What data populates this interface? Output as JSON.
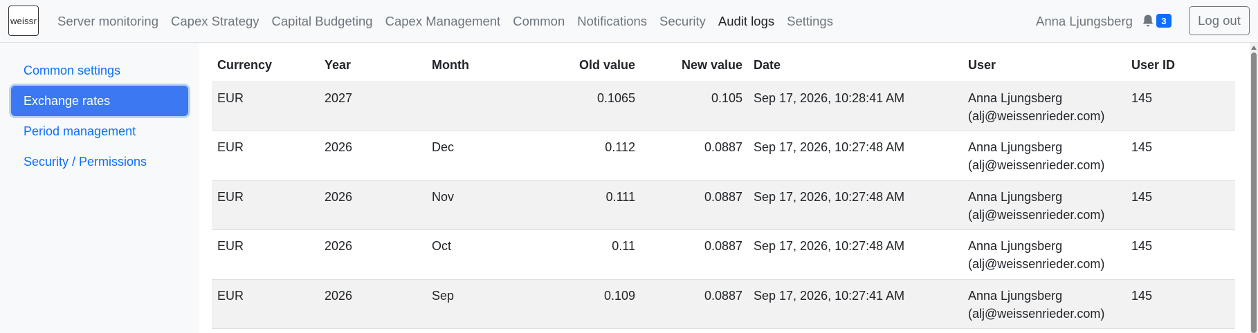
{
  "brand": {
    "text": "weissr"
  },
  "nav": {
    "links": [
      {
        "label": "Server monitoring"
      },
      {
        "label": "Capex Strategy"
      },
      {
        "label": "Capital Budgeting"
      },
      {
        "label": "Capex Management"
      },
      {
        "label": "Common"
      },
      {
        "label": "Notifications"
      },
      {
        "label": "Security"
      },
      {
        "label": "Audit logs"
      },
      {
        "label": "Settings"
      }
    ],
    "user_name": "Anna Ljungsberg",
    "notification_count": "3",
    "logout_label": "Log out"
  },
  "sidebar": {
    "items": [
      {
        "label": "Common settings"
      },
      {
        "label": "Exchange rates"
      },
      {
        "label": "Period management"
      },
      {
        "label": "Security / Permissions"
      }
    ]
  },
  "table": {
    "headers": {
      "currency": "Currency",
      "year": "Year",
      "month": "Month",
      "old_value": "Old value",
      "new_value": "New value",
      "date": "Date",
      "user": "User",
      "user_id": "User ID"
    },
    "rows": [
      {
        "currency": "EUR",
        "year": "2027",
        "month": "",
        "old_value": "0.1065",
        "new_value": "0.105",
        "date": "Sep 17, 2026, 10:28:41 AM",
        "user_name": "Anna Ljungsberg",
        "user_email": "(alj@weissenrieder.com)",
        "user_id": "145"
      },
      {
        "currency": "EUR",
        "year": "2026",
        "month": "Dec",
        "old_value": "0.112",
        "new_value": "0.0887",
        "date": "Sep 17, 2026, 10:27:48 AM",
        "user_name": "Anna Ljungsberg",
        "user_email": "(alj@weissenrieder.com)",
        "user_id": "145"
      },
      {
        "currency": "EUR",
        "year": "2026",
        "month": "Nov",
        "old_value": "0.111",
        "new_value": "0.0887",
        "date": "Sep 17, 2026, 10:27:48 AM",
        "user_name": "Anna Ljungsberg",
        "user_email": "(alj@weissenrieder.com)",
        "user_id": "145"
      },
      {
        "currency": "EUR",
        "year": "2026",
        "month": "Oct",
        "old_value": "0.11",
        "new_value": "0.0887",
        "date": "Sep 17, 2026, 10:27:48 AM",
        "user_name": "Anna Ljungsberg",
        "user_email": "(alj@weissenrieder.com)",
        "user_id": "145"
      },
      {
        "currency": "EUR",
        "year": "2026",
        "month": "Sep",
        "old_value": "0.109",
        "new_value": "0.0887",
        "date": "Sep 17, 2026, 10:27:41 AM",
        "user_name": "Anna Ljungsberg",
        "user_email": "(alj@weissenrieder.com)",
        "user_id": "145"
      }
    ]
  },
  "colors": {
    "accent": "#0d6efd",
    "active_sidebar": "#3b78f2",
    "striped_row": "#f2f2f2"
  }
}
